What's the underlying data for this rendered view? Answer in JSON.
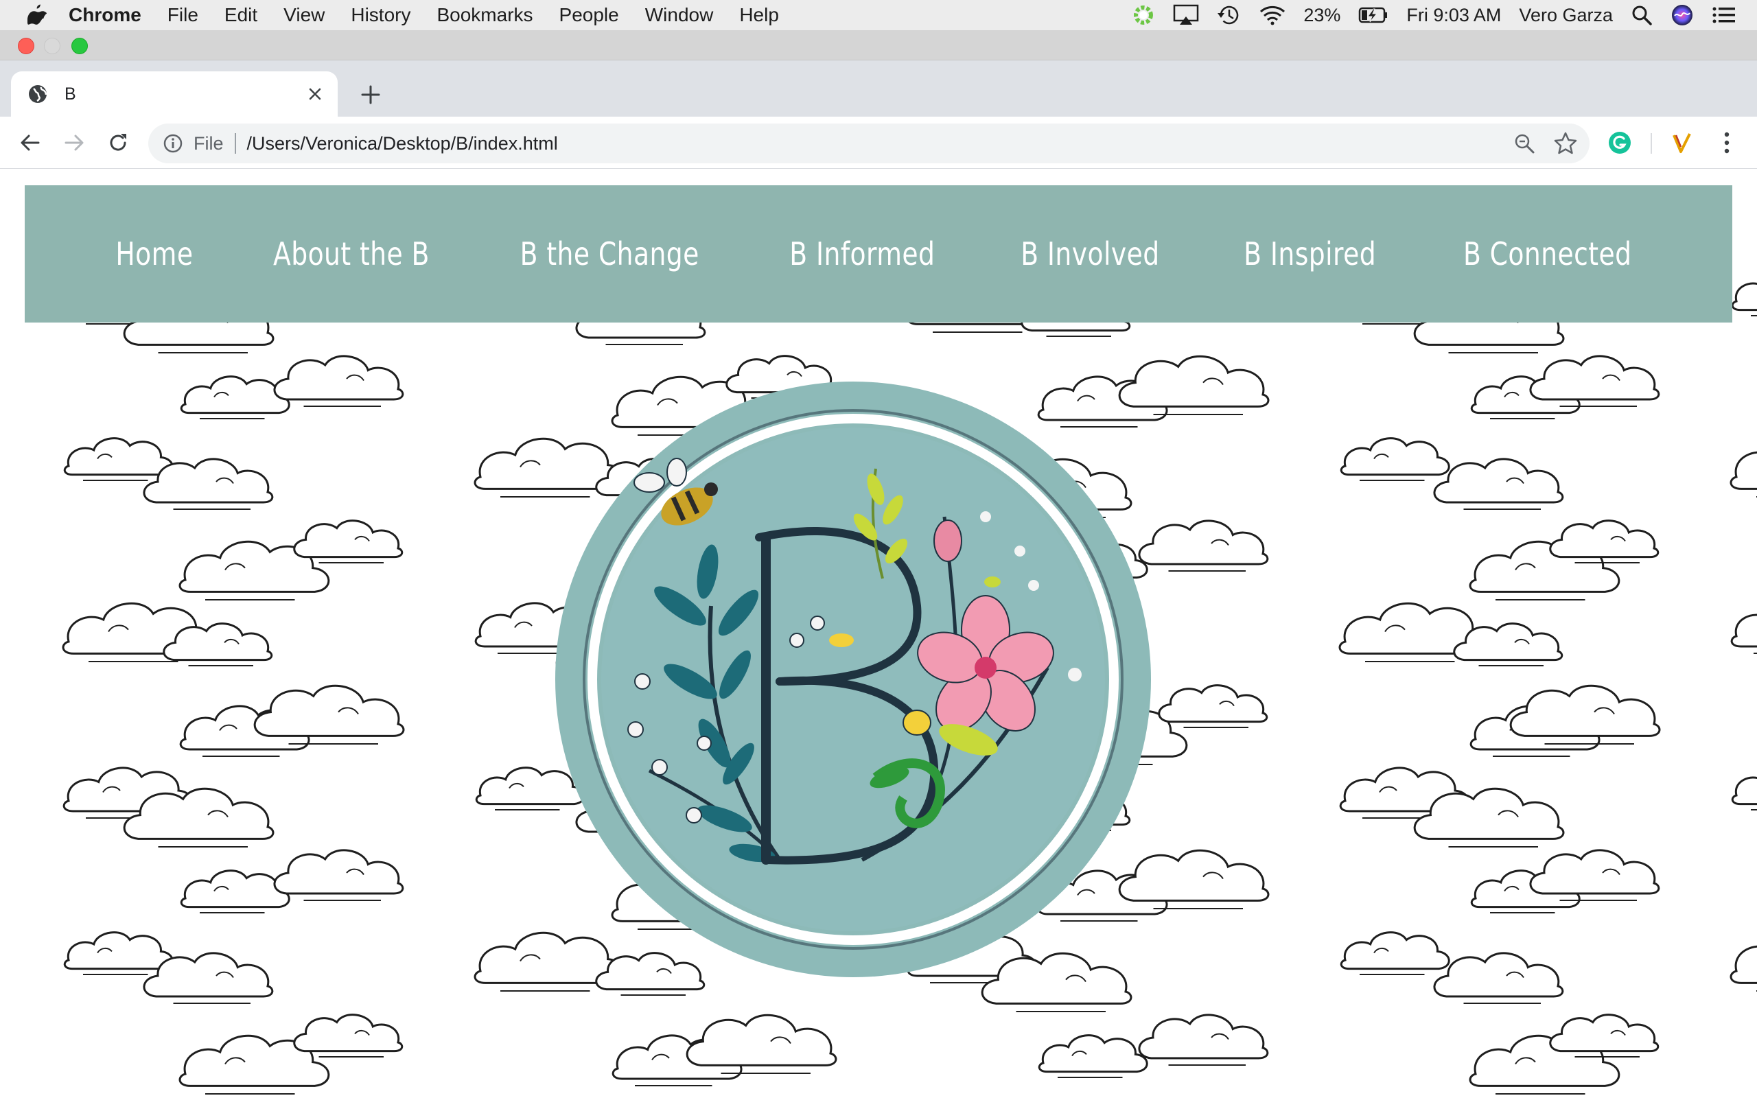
{
  "menubar": {
    "app_name": "Chrome",
    "items": [
      "File",
      "Edit",
      "View",
      "History",
      "Bookmarks",
      "People",
      "Window",
      "Help"
    ],
    "battery": "23%",
    "clock": "Fri 9:03 AM",
    "user": "Vero Garza"
  },
  "browser": {
    "tab": {
      "title": "B"
    },
    "omnibox": {
      "scheme": "File",
      "url": "/Users/Veronica/Desktop/B/index.html"
    }
  },
  "site": {
    "nav": [
      {
        "label": "Home"
      },
      {
        "label": "About the B"
      },
      {
        "label": "B the Change"
      },
      {
        "label": "B Informed"
      },
      {
        "label": "B Involved"
      },
      {
        "label": "B Inspired"
      },
      {
        "label": "B Connected"
      }
    ],
    "logo": {
      "letter": "B"
    }
  },
  "colors": {
    "nav_background": "#8fb5af",
    "logo_background": "#8dbab8",
    "logo_ring": "#ffffff",
    "cloud_stroke": "#1e1e1e"
  }
}
